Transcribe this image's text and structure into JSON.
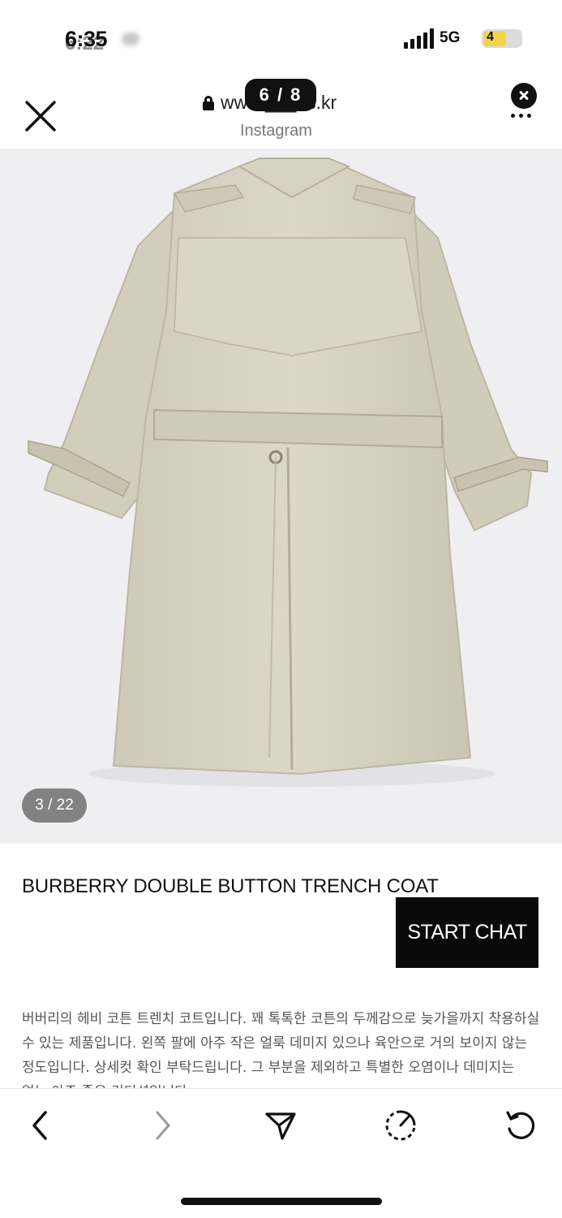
{
  "status_bar": {
    "time": "6:35",
    "time_overlay": "6:22",
    "network": "5G",
    "battery": "4"
  },
  "browser": {
    "url": "www.___ns.kr",
    "source": "Instagram",
    "page_indicator": "6 / 8"
  },
  "gallery": {
    "counter": "3 / 22"
  },
  "product": {
    "title": "BURBERRY DOUBLE BUTTON TRENCH COAT",
    "chat_button": "START CHAT",
    "description": "버버리의 헤비 코튼 트렌치 코트입니다. 꽤 톡톡한 코튼의 두께감으로 늦가을까지 착용하실 수 있는 제품입니다. 왼쪽 팔에 아주 작은 얼룩 데미지 있으나 육안으로 거의 보이지 않는 정도입니다. 상세컷 확인 부탁드립니다. 그 부분을 제외하고 특별한 오염이나 데미지는 없는 아주 좋은 컨디션입니다."
  },
  "toolbar": {
    "icons": [
      "back-icon",
      "forward-icon",
      "share-icon",
      "speed-icon",
      "reload-icon"
    ]
  },
  "colors": {
    "accent": "#0a0a0a",
    "coat": "#d8d2c2",
    "photo_background": "#efeff2",
    "counter_pill": "#6e6e6e"
  }
}
